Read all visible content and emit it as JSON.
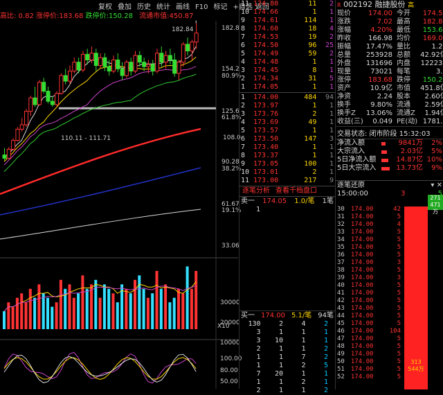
{
  "toolbar": {
    "items": [
      "复权",
      "叠加",
      "历史",
      "统计",
      "画线",
      "F10",
      "标记",
      "+自选",
      "返回"
    ],
    "info": {
      "limit_down_label": "跌停价:",
      "limit_down_partial": "高比: 0.82",
      "limit_up_label": "涨停价:",
      "limit_up": "183.68",
      "limit_down2_label": "跌停价:",
      "limit_down2": "150.28",
      "float_cap_label": "流通市值:",
      "float_cap": "450.87"
    }
  },
  "price_axis": [
    "182.8",
    "154.2",
    "80.9%",
    "125.6",
    "61.8%",
    "108.0",
    "90.28",
    "38.2%",
    "61.67",
    "19.1%",
    "33.06"
  ],
  "annotations": {
    "high": "182.84",
    "range": "110.11 - 111.71",
    "line_val": "108.0"
  },
  "volume_axis": [
    "30000",
    "20000",
    "10000"
  ],
  "volume_mult": "X10",
  "macd_axis": [
    "100.00",
    "80.00",
    "50.00"
  ],
  "chart_data": {
    "type": "candlestick",
    "title": "",
    "note": "approximate daily candles read from chart",
    "candles": [
      {
        "o": 65,
        "h": 71,
        "l": 60,
        "c": 62
      },
      {
        "o": 62,
        "h": 72,
        "l": 61,
        "c": 70
      },
      {
        "o": 70,
        "h": 80,
        "l": 69,
        "c": 78
      },
      {
        "o": 78,
        "h": 90,
        "l": 77,
        "c": 88
      },
      {
        "o": 88,
        "h": 98,
        "l": 86,
        "c": 92
      },
      {
        "o": 92,
        "h": 106,
        "l": 90,
        "c": 104
      },
      {
        "o": 104,
        "h": 118,
        "l": 100,
        "c": 116
      },
      {
        "o": 116,
        "h": 126,
        "l": 108,
        "c": 110
      },
      {
        "o": 110,
        "h": 132,
        "l": 109,
        "c": 130
      },
      {
        "o": 130,
        "h": 134,
        "l": 120,
        "c": 122
      },
      {
        "o": 122,
        "h": 126,
        "l": 111,
        "c": 113
      },
      {
        "o": 113,
        "h": 117,
        "l": 108,
        "c": 110
      },
      {
        "o": 110,
        "h": 122,
        "l": 108,
        "c": 120
      },
      {
        "o": 120,
        "h": 138,
        "l": 119,
        "c": 136
      },
      {
        "o": 136,
        "h": 142,
        "l": 128,
        "c": 131
      },
      {
        "o": 131,
        "h": 145,
        "l": 128,
        "c": 140
      },
      {
        "o": 140,
        "h": 152,
        "l": 138,
        "c": 148
      },
      {
        "o": 148,
        "h": 152,
        "l": 138,
        "c": 141
      },
      {
        "o": 141,
        "h": 158,
        "l": 139,
        "c": 155
      },
      {
        "o": 155,
        "h": 160,
        "l": 146,
        "c": 150
      },
      {
        "o": 150,
        "h": 162,
        "l": 147,
        "c": 156
      },
      {
        "o": 156,
        "h": 160,
        "l": 140,
        "c": 145
      },
      {
        "o": 145,
        "h": 156,
        "l": 142,
        "c": 152
      },
      {
        "o": 152,
        "h": 156,
        "l": 140,
        "c": 144
      },
      {
        "o": 144,
        "h": 150,
        "l": 136,
        "c": 140
      },
      {
        "o": 140,
        "h": 154,
        "l": 138,
        "c": 150
      },
      {
        "o": 150,
        "h": 156,
        "l": 139,
        "c": 142
      },
      {
        "o": 142,
        "h": 148,
        "l": 132,
        "c": 136
      },
      {
        "o": 136,
        "h": 150,
        "l": 134,
        "c": 148
      },
      {
        "o": 148,
        "h": 152,
        "l": 136,
        "c": 140
      },
      {
        "o": 140,
        "h": 158,
        "l": 138,
        "c": 154
      },
      {
        "o": 154,
        "h": 158,
        "l": 144,
        "c": 148
      },
      {
        "o": 148,
        "h": 152,
        "l": 140,
        "c": 144
      },
      {
        "o": 144,
        "h": 150,
        "l": 138,
        "c": 146
      },
      {
        "o": 146,
        "h": 150,
        "l": 136,
        "c": 140
      },
      {
        "o": 140,
        "h": 160,
        "l": 138,
        "c": 156
      },
      {
        "o": 156,
        "h": 162,
        "l": 144,
        "c": 148
      },
      {
        "o": 148,
        "h": 158,
        "l": 142,
        "c": 154
      },
      {
        "o": 154,
        "h": 160,
        "l": 146,
        "c": 150
      },
      {
        "o": 150,
        "h": 156,
        "l": 135,
        "c": 138
      },
      {
        "o": 138,
        "h": 150,
        "l": 132,
        "c": 148
      },
      {
        "o": 148,
        "h": 166,
        "l": 144,
        "c": 164
      },
      {
        "o": 164,
        "h": 170,
        "l": 154,
        "c": 158
      },
      {
        "o": 158,
        "h": 168,
        "l": 150,
        "c": 166
      },
      {
        "o": 166,
        "h": 182.84,
        "l": 160,
        "c": 174
      }
    ],
    "volumes": [
      8,
      12,
      10,
      14,
      16,
      12,
      18,
      14,
      20,
      16,
      14,
      10,
      12,
      22,
      18,
      20,
      14,
      16,
      24,
      18,
      20,
      22,
      14,
      20,
      18,
      16,
      12,
      20,
      18,
      16,
      22,
      24,
      18,
      14,
      16,
      26,
      18,
      20,
      12,
      14,
      18,
      16,
      28,
      18,
      26
    ]
  },
  "quote": {
    "code": "002192",
    "name": "融捷股份",
    "badge": "高",
    "rows": [
      {
        "l1": "现价",
        "v1": "174.00",
        "l2": "今开",
        "v2": "174.50"
      },
      {
        "l1": "涨跌",
        "v1": "7.02",
        "l2": "最高",
        "v2": "182.84"
      },
      {
        "l1": "涨幅",
        "v1": "4.20%",
        "l2": "最低",
        "v2": "153.67"
      },
      {
        "l1": "昨收",
        "v1": "166.98",
        "l2": "均价",
        "v2": "169.09"
      },
      {
        "l1": "振幅",
        "v1": "17.47%",
        "l2": "量比",
        "v2": "1.29"
      },
      {
        "l1": "总量",
        "v1": "253928",
        "l2": "总额",
        "v2": "42.92亿"
      },
      {
        "l1": "外盘",
        "v1": "131696",
        "l2": "内盘",
        "v2": "122232"
      },
      {
        "l1": "现量",
        "v1": "73021",
        "l2": "每笔",
        "v2": "3.5"
      },
      {
        "l1": "涨停",
        "v1": "183.68",
        "l2": "跌停",
        "v2": "150.28"
      },
      {
        "l1": "资产",
        "v1": "10.9亿",
        "l2": "市值",
        "v2": "451.8亿"
      },
      {
        "l1": "净资",
        "v1": "2.24",
        "l2": "股本",
        "v2": "2.60亿"
      },
      {
        "l1": "换手",
        "v1": "9.80%",
        "l2": "流通",
        "v2": "2.59亿"
      },
      {
        "l1": "换手Z",
        "v1": "13.06%",
        "l2": "流通Z",
        "v2": "1.94亿"
      },
      {
        "l1": "收益(三)",
        "v1": "0.049",
        "l2": "PE(动)",
        "v2": "1781.9"
      }
    ],
    "trade_status": "交易状态: 闭市阶段 15:32:03",
    "flows": [
      {
        "label": "净流入额",
        "value": "9841万",
        "pct": "2%"
      },
      {
        "label": "大宗流入",
        "value": "2.03亿",
        "pct": "5%"
      },
      {
        "label": "5日净流入额",
        "value": "14.87亿",
        "pct": "10%"
      },
      {
        "label": "5日大宗流入",
        "value": "13.73亿",
        "pct": "9%"
      }
    ]
  },
  "asks": [
    {
      "n": "11",
      "p": "174.80",
      "v": "11",
      "c": "2"
    },
    {
      "n": "10",
      "p": "174.66",
      "v": "1",
      "c": "1"
    },
    {
      "n": "9",
      "p": "174.61",
      "v": "114",
      "c": "1"
    },
    {
      "n": "8",
      "p": "174.60",
      "v": "18",
      "c": "4"
    },
    {
      "n": "7",
      "p": "174.53",
      "v": "19",
      "c": "2"
    },
    {
      "n": "6",
      "p": "174.50",
      "v": "96",
      "c": "25"
    },
    {
      "n": "5",
      "p": "174.49",
      "v": "59",
      "c": "2"
    },
    {
      "n": "4",
      "p": "174.48",
      "v": "1",
      "c": "1"
    },
    {
      "n": "3",
      "p": "174.45",
      "v": "8",
      "c": "1"
    },
    {
      "n": "2",
      "p": "174.34",
      "v": "31",
      "c": "5"
    },
    {
      "n": "1",
      "p": "174.05",
      "v": "1",
      "c": "1"
    }
  ],
  "bids": [
    {
      "n": "1",
      "p": "174.00",
      "v": "484",
      "c": "94"
    },
    {
      "n": "2",
      "p": "173.97",
      "v": "1",
      "c": "1"
    },
    {
      "n": "3",
      "p": "173.76",
      "v": "2",
      "c": "1"
    },
    {
      "n": "4",
      "p": "173.69",
      "v": "49",
      "c": "1"
    },
    {
      "n": "5",
      "p": "173.57",
      "v": "1",
      "c": "1"
    },
    {
      "n": "6",
      "p": "173.50",
      "v": "147",
      "c": "3"
    },
    {
      "n": "7",
      "p": "173.40",
      "v": "1",
      "c": "1"
    },
    {
      "n": "8",
      "p": "173.37",
      "v": "1",
      "c": "1"
    },
    {
      "n": "9",
      "p": "173.05",
      "v": "100",
      "c": "1"
    },
    {
      "n": "10",
      "p": "173.01",
      "v": "2",
      "c": "1"
    },
    {
      "n": "11",
      "p": "173.00",
      "v": "217",
      "c": "9"
    }
  ],
  "tabs": {
    "left": "逐笔分析",
    "right": "查看千档盘口"
  },
  "sell1": {
    "label": "卖一",
    "price": "174.05",
    "qty": "1.0/笔",
    "count": "1笔",
    "orders": [
      "1"
    ]
  },
  "buy1": {
    "label": "买一",
    "price": "174.00",
    "qty": "5.1/笔",
    "count": "94笔",
    "grid": [
      [
        "130",
        "2",
        "4",
        "2"
      ],
      [
        "3",
        "1",
        "1",
        "1"
      ],
      [
        "3",
        "10",
        "1",
        "1"
      ],
      [
        "2",
        "1",
        "1",
        "2"
      ],
      [
        "1",
        "1",
        "7",
        "2"
      ],
      [
        "1",
        "1",
        "2",
        "5"
      ],
      [
        "7",
        "20",
        "1",
        "1"
      ],
      [
        "1",
        "1",
        "2",
        "1"
      ],
      [
        "2",
        "1",
        "1",
        "2"
      ]
    ]
  },
  "restore": {
    "title": "逐笔还原",
    "time": "15:00:00",
    "price": "174.00",
    "bar1": "271",
    "bar1b": "471万",
    "bar2": "313",
    "bar2b": "544万",
    "rows": [
      {
        "n": "30",
        "p": "174.00",
        "v": "42",
        "s": "0"
      },
      {
        "n": "31",
        "p": "174.00",
        "v": "5",
        "s": "0"
      },
      {
        "n": "32",
        "p": "174.00",
        "v": "4",
        "s": "0"
      },
      {
        "n": "33",
        "p": "174.00",
        "v": "5",
        "s": "0"
      },
      {
        "n": "34",
        "p": "174.00",
        "v": "5",
        "s": "0"
      },
      {
        "n": "35",
        "p": "174.00",
        "v": "5",
        "s": "0"
      },
      {
        "n": "36",
        "p": "174.00",
        "v": "5",
        "s": "0"
      },
      {
        "n": "37",
        "p": "174.00",
        "v": "3",
        "s": "0"
      },
      {
        "n": "38",
        "p": "174.00",
        "v": "5",
        "s": "0"
      },
      {
        "n": "39",
        "p": "174.00",
        "v": "3",
        "s": "0"
      },
      {
        "n": "40",
        "p": "174.00",
        "v": "5",
        "s": "0"
      },
      {
        "n": "41",
        "p": "174.00",
        "v": "5",
        "s": "0"
      },
      {
        "n": "42",
        "p": "174.00",
        "v": "5",
        "s": "0"
      },
      {
        "n": "43",
        "p": "174.00",
        "v": "5",
        "s": "0"
      },
      {
        "n": "44",
        "p": "174.00",
        "v": "5",
        "s": "0"
      },
      {
        "n": "45",
        "p": "174.00",
        "v": "5",
        "s": "0"
      },
      {
        "n": "46",
        "p": "174.00",
        "v": "104",
        "s": "0"
      },
      {
        "n": "47",
        "p": "174.00",
        "v": "5",
        "s": "0"
      },
      {
        "n": "48",
        "p": "174.00",
        "v": "5",
        "s": "0"
      },
      {
        "n": "49",
        "p": "174.00",
        "v": "5",
        "s": "0"
      },
      {
        "n": "50",
        "p": "174.00",
        "v": "5",
        "s": "0"
      },
      {
        "n": "51",
        "p": "174.00",
        "v": "5",
        "s": "0"
      },
      {
        "n": "52",
        "p": "174.00",
        "v": "5",
        "s": "0"
      }
    ],
    "first_row": {
      "n": "",
      "p": "",
      "v": "3",
      "s": "5"
    }
  },
  "colors": {
    "up": "#ff3333",
    "down": "#33dd33",
    "bg": "#000000",
    "accent": "#ffd700"
  }
}
